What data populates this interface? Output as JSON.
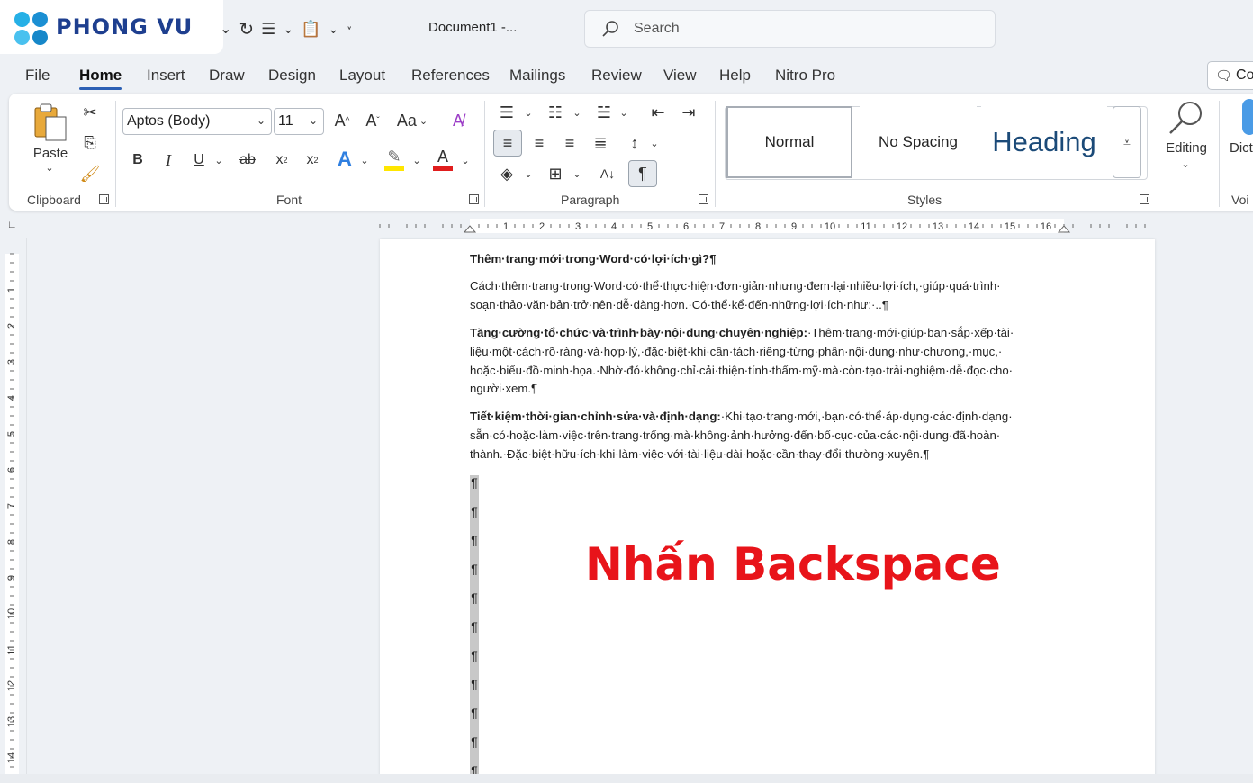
{
  "logo": {
    "text": "PHONG VU"
  },
  "titlebar": {
    "doc_title": "Document1  -...",
    "search_placeholder": "Search"
  },
  "tabs": [
    "File",
    "Home",
    "Insert",
    "Draw",
    "Design",
    "Layout",
    "References",
    "Mailings",
    "Review",
    "View",
    "Help",
    "Nitro Pro"
  ],
  "active_tab": "Home",
  "comments_label": "Cor",
  "ribbon": {
    "clipboard": {
      "paste_label": "Paste",
      "group_label": "Clipboard"
    },
    "font": {
      "font_name": "Aptos (Body)",
      "font_size": "11",
      "group_label": "Font",
      "bold": "B",
      "italic": "I",
      "underline": "U",
      "strike": "ab",
      "case_label": "Aa"
    },
    "paragraph": {
      "group_label": "Paragraph"
    },
    "styles": {
      "group_label": "Styles",
      "items": [
        "Normal",
        "No Spacing",
        "Heading"
      ]
    },
    "editing": {
      "label": "Editing"
    },
    "dictate": {
      "label": "Dict",
      "group_label": "Voi"
    }
  },
  "document": {
    "heading": "Thêm·trang·mới·trong·Word·có·lợi·ích·gì?¶",
    "para1": "Cách·thêm·trang·trong·Word·có·thể·thực·hiện·đơn·giản·nhưng·đem·lại·nhiều·lợi·ích,·giúp·quá·trình· soạn·thảo·văn·bản·trở·nên·dễ·dàng·hơn.·Có·thể·kể·đến·những·lợi·ích·như:·..¶",
    "para2_bold": "Tăng·cường·tổ·chức·và·trình·bày·nội·dung·chuyên·nghiệp:",
    "para2_text": "·Thêm·trang·mới·giúp·bạn·sắp·xếp·tài· liệu·một·cách·rõ·ràng·và·hợp·lý,·đặc·biệt·khi·cần·tách·riêng·từng·phần·nội·dung·như·chương,·mục,· hoặc·biểu·đồ·minh·họa.·Nhờ·đó·không·chỉ·cải·thiện·tính·thẩm·mỹ·mà·còn·tạo·trải·nghiệm·dễ·đọc·cho· người·xem.¶",
    "para3_bold": "Tiết·kiệm·thời·gian·chỉnh·sửa·và·định·dạng:",
    "para3_text": "·Khi·tạo·trang·mới,·bạn·có·thể·áp·dụng·các·định·dạng· sẵn·có·hoặc·làm·việc·trên·trang·trống·mà·không·ảnh·hưởng·đến·bố·cục·của·các·nội·dung·đã·hoàn· thành.·Đặc·biệt·hữu·ích·khi·làm·việc·với·tài·liệu·dài·hoặc·cần·thay·đổi·thường·xuyên.¶",
    "pilcrow": "¶",
    "overlay": "Nhấn Backspace"
  },
  "ruler": {
    "h_numbers": [
      "1",
      "2",
      "3",
      "4",
      "5",
      "6",
      "7",
      "8",
      "9",
      "10",
      "11",
      "12",
      "13",
      "14",
      "15",
      "16"
    ],
    "v_numbers": [
      "1",
      "2",
      "3",
      "4",
      "5",
      "6",
      "7",
      "8",
      "9",
      "10",
      "11",
      "12",
      "13",
      "14"
    ]
  },
  "colors": {
    "accent": "#2b5fb4",
    "overlay_red": "#e8141a",
    "logo_blue": "#1e3f8f"
  }
}
